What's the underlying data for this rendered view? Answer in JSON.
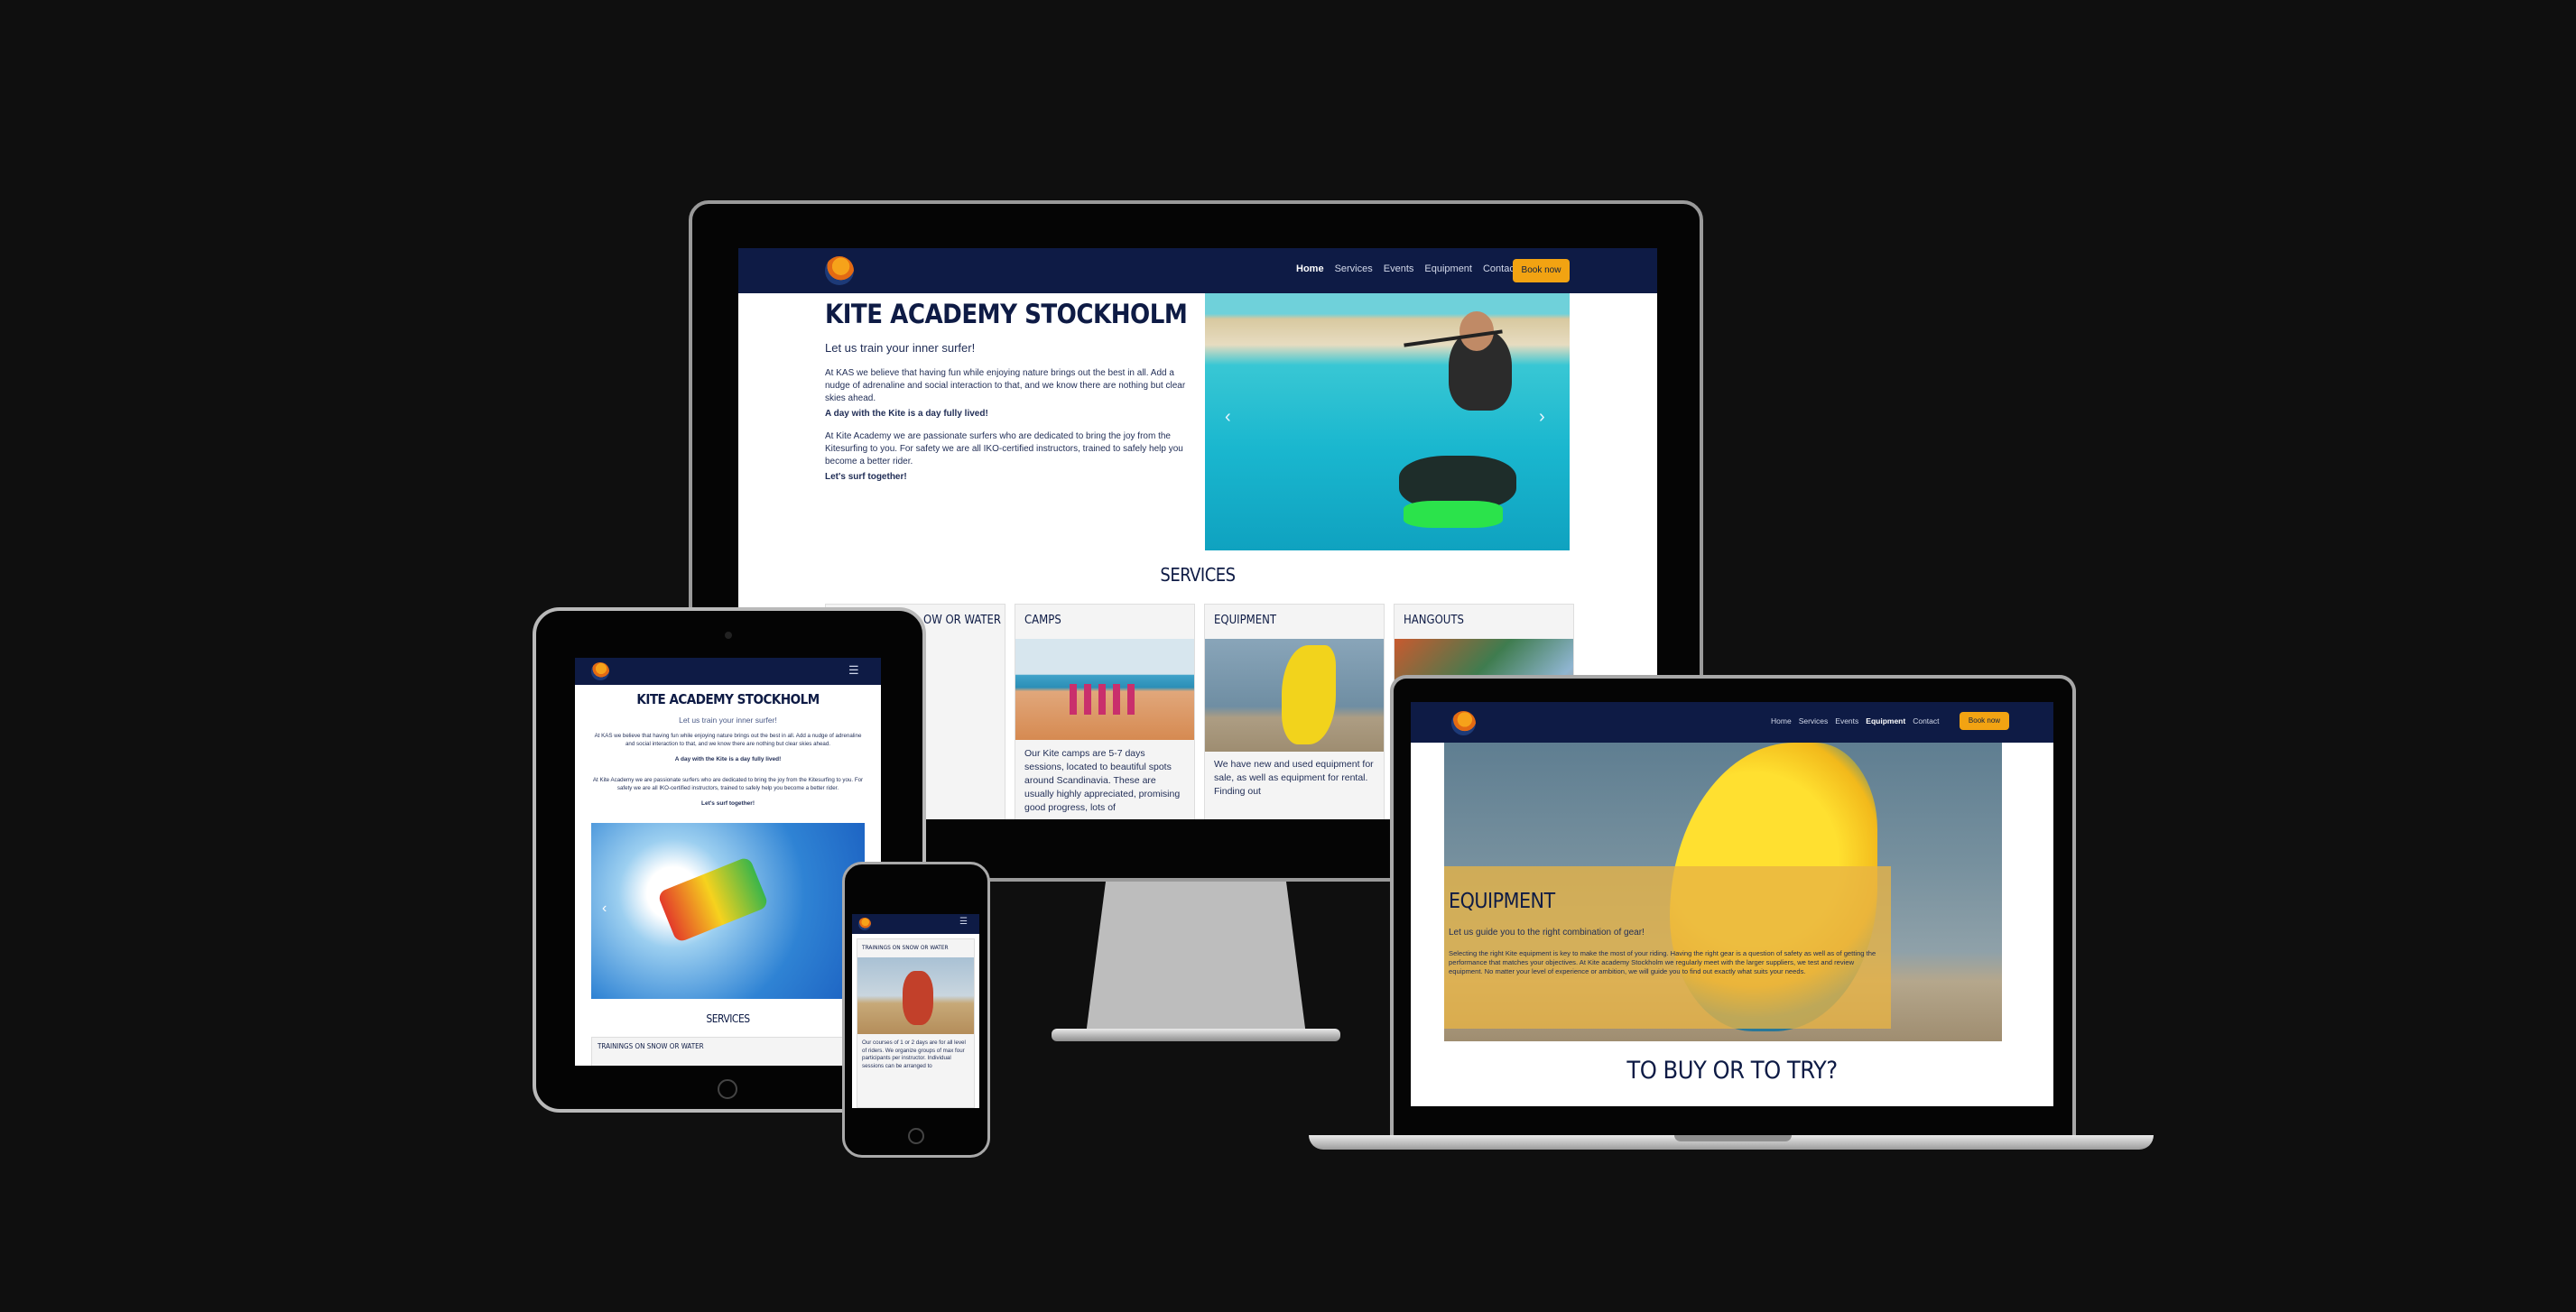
{
  "site": {
    "title": "KITE ACADEMY STOCKHOLM",
    "tagline": "Let us train your inner surfer!",
    "para1": "At KAS we believe that having fun while enjoying nature brings out the best in all. Add a nudge of adrenaline and social interaction to that, and we know there are nothing but clear skies ahead.",
    "bold1": "A day with the Kite is a day fully lived!",
    "para2": "At Kite Academy we are passionate surfers who are dedicated to bring the joy from the Kitesurfing to you. For safety we are all IKO-certified instructors, trained to safely help you become a better rider.",
    "bold2": "Let's surf together!"
  },
  "nav": {
    "home": "Home",
    "services": "Services",
    "events": "Events",
    "equipment": "Equipment",
    "contact": "Contact",
    "book": "Book now"
  },
  "services": {
    "heading": "SERVICES",
    "cards": [
      {
        "title": "TRAININGS ON SNOW OR WATER",
        "text": "Our courses of 1 or 2 days are for all level of riders. We organize groups of max four participants per instructor. Individual sessions can be arranged to"
      },
      {
        "title": "CAMPS",
        "text": "Our Kite camps are 5-7 days sessions, located to beautiful spots around Scandinavia. These are usually highly appreciated, promising good progress, lots of"
      },
      {
        "title": "EQUIPMENT",
        "text": "We have new and used equipment for sale, as well as equipment for rental. Finding out"
      },
      {
        "title": "HANGOUTS",
        "text": ""
      }
    ],
    "fragment_title": "OW OR WATER",
    "fragment_lines": [
      "days are for",
      "organize",
      "participants"
    ]
  },
  "equipment_page": {
    "title": "EQUIPMENT",
    "subtitle": "Let us guide you to the right combination of gear!",
    "text": "Selecting the right Kite equipment is key to make the most of your riding. Having the right gear is a question of safety as well as of getting the performance that matches your objectives. At Kite academy Stockholm we regularly meet with the larger suppliers, we test and review equipment. No matter your level of experience or ambition, we will guide you to find out exactly what suits your needs.",
    "next_heading": "TO BUY OR TO TRY?"
  },
  "icons": {
    "hamburger": "hamburger-icon",
    "prev": "chevron-left-icon",
    "next": "chevron-right-icon",
    "logo": "kas-logo-icon"
  },
  "colors": {
    "navy": "#0e1b45",
    "accent": "#f2a312",
    "background": "#0f0f0f"
  }
}
